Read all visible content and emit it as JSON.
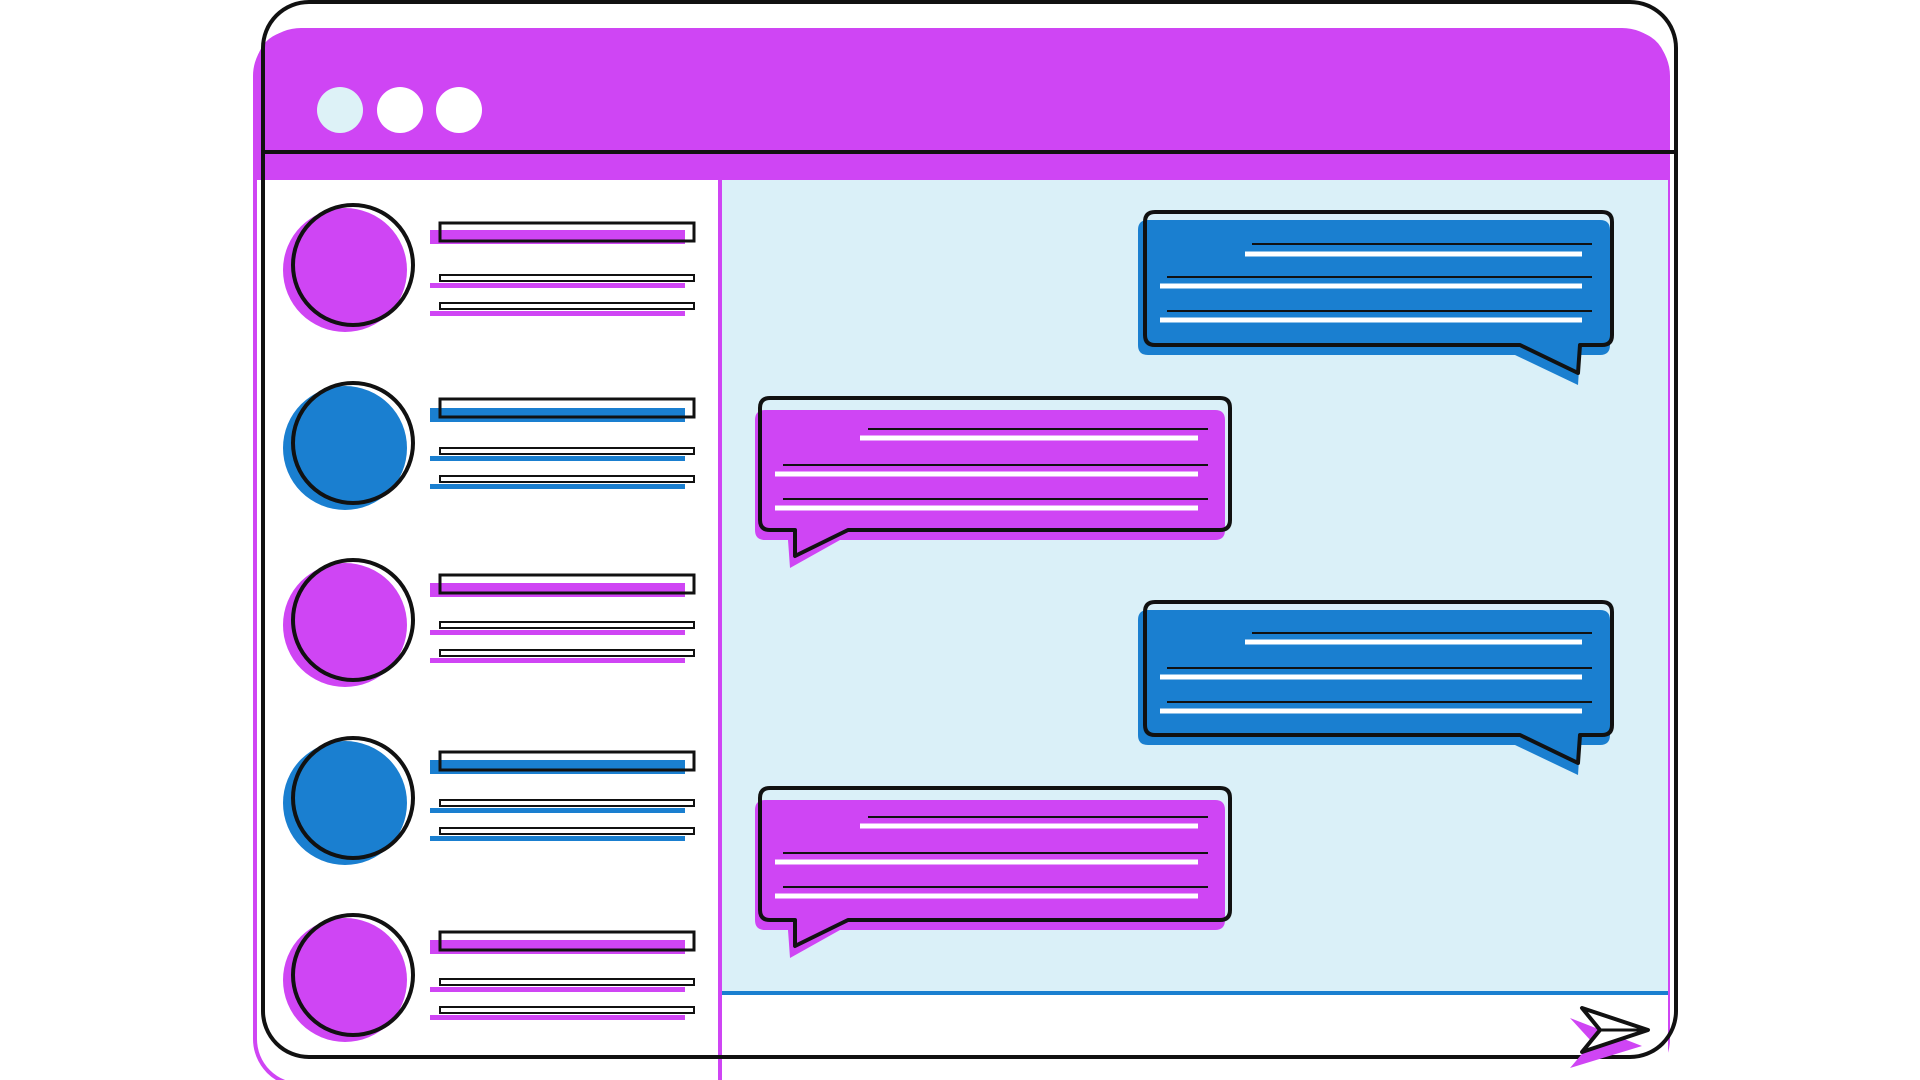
{
  "colors": {
    "accent_purple": "#CF45F4",
    "accent_blue": "#1A7FD0",
    "chat_bg": "#DAF0F8",
    "outline": "#111111",
    "window_dot": "#DDF2F7"
  },
  "window": {
    "title_bar": {
      "controls": [
        "close-dot",
        "minimize-dot",
        "maximize-dot"
      ]
    }
  },
  "contacts": [
    {
      "avatar_color": "purple"
    },
    {
      "avatar_color": "blue"
    },
    {
      "avatar_color": "purple"
    },
    {
      "avatar_color": "blue"
    },
    {
      "avatar_color": "purple"
    }
  ],
  "messages": [
    {
      "side": "right",
      "color": "blue"
    },
    {
      "side": "left",
      "color": "purple"
    },
    {
      "side": "right",
      "color": "blue"
    },
    {
      "side": "left",
      "color": "purple"
    }
  ],
  "composer": {
    "send_icon": "send-icon"
  }
}
